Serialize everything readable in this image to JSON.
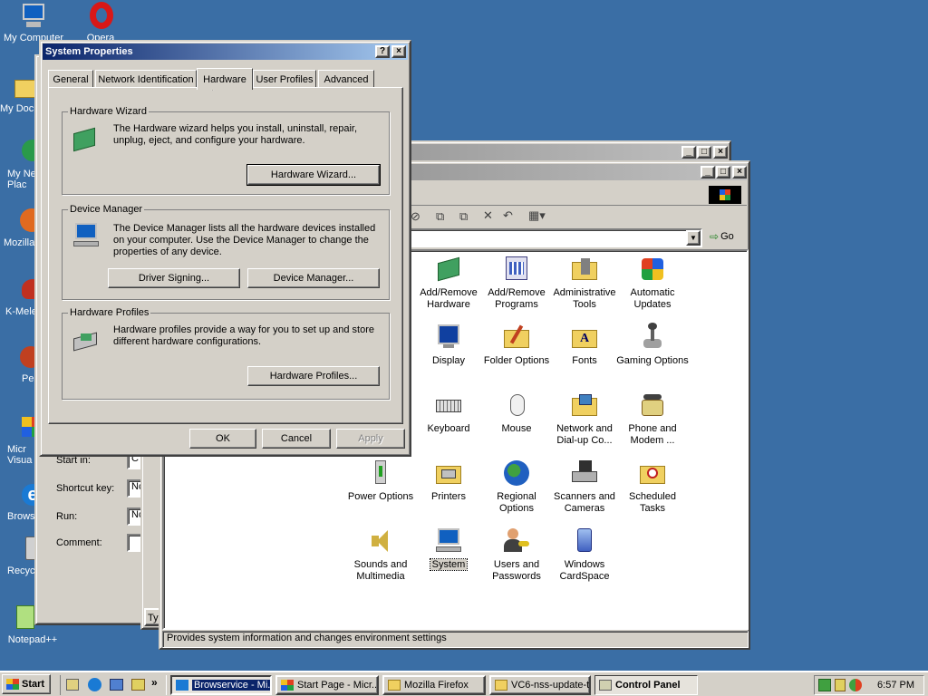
{
  "desktop": {
    "icons": [
      {
        "label": "My Computer"
      },
      {
        "label": "Opera"
      },
      {
        "label": "My Docu"
      },
      {
        "label": "My Net Plac"
      },
      {
        "label": "Mozilla"
      },
      {
        "label": "K-Mele"
      },
      {
        "label": "Pe"
      },
      {
        "label": "Micr Visua"
      },
      {
        "label": "Brows"
      },
      {
        "label": "Recyc"
      },
      {
        "label": "Notepad++"
      }
    ]
  },
  "bg_window": {
    "rows": [
      {
        "label": "Start in:",
        "value": "C"
      },
      {
        "label": "Shortcut key:",
        "value": "Nc"
      },
      {
        "label": "Run:",
        "value": "Nc"
      },
      {
        "label": "Comment:",
        "value": ""
      }
    ],
    "tab_stub": "Typ"
  },
  "control_panel": {
    "address_go": "Go",
    "status": "Provides system information and changes environment settings",
    "items": [
      {
        "label": "Add/Remove Hardware"
      },
      {
        "label": "Add/Remove Programs"
      },
      {
        "label": "Administrative Tools"
      },
      {
        "label": "Automatic Updates"
      },
      {
        "label": "Display"
      },
      {
        "label": "Folder Options"
      },
      {
        "label": "Fonts"
      },
      {
        "label": "Gaming Options"
      },
      {
        "label": "Keyboard"
      },
      {
        "label": "Mouse"
      },
      {
        "label": "Network and Dial-up Co..."
      },
      {
        "label": "Phone and Modem ..."
      },
      {
        "label": "Power Options"
      },
      {
        "label": "Printers"
      },
      {
        "label": "Regional Options"
      },
      {
        "label": "Scanners and Cameras"
      },
      {
        "label": "Scheduled Tasks"
      },
      {
        "label": "Sounds and Multimedia"
      },
      {
        "label": "System"
      },
      {
        "label": "Users and Passwords"
      },
      {
        "label": "Windows CardSpace"
      }
    ]
  },
  "dialog": {
    "title": "System Properties",
    "help_btn": "?",
    "close_btn": "×",
    "tabs": [
      {
        "label": "General"
      },
      {
        "label": "Network Identification"
      },
      {
        "label": "Hardware"
      },
      {
        "label": "User Profiles"
      },
      {
        "label": "Advanced"
      }
    ],
    "wizard": {
      "title": "Hardware Wizard",
      "text": "The Hardware wizard helps you install, uninstall, repair, unplug, eject, and configure your hardware.",
      "button": "Hardware Wizard..."
    },
    "devmgr": {
      "title": "Device Manager",
      "text": "The Device Manager lists all the hardware devices installed on your computer. Use the Device Manager to change the properties of any device.",
      "btn1": "Driver Signing...",
      "btn2": "Device Manager..."
    },
    "profiles": {
      "title": "Hardware Profiles",
      "text": "Hardware profiles provide a way for you to set up and store different hardware configurations.",
      "button": "Hardware Profiles..."
    },
    "ok": "OK",
    "cancel": "Cancel",
    "apply": "Apply"
  },
  "taskbar": {
    "start": "Start",
    "tasks": [
      {
        "label": "Browservice - Mi..."
      },
      {
        "label": "Start Page - Micr..."
      },
      {
        "label": "Mozilla Firefox"
      },
      {
        "label": "VC6-nss-update-t..."
      },
      {
        "label": "Control Panel"
      }
    ],
    "clock": "6:57 PM",
    "quicklaunch_more": "»"
  }
}
